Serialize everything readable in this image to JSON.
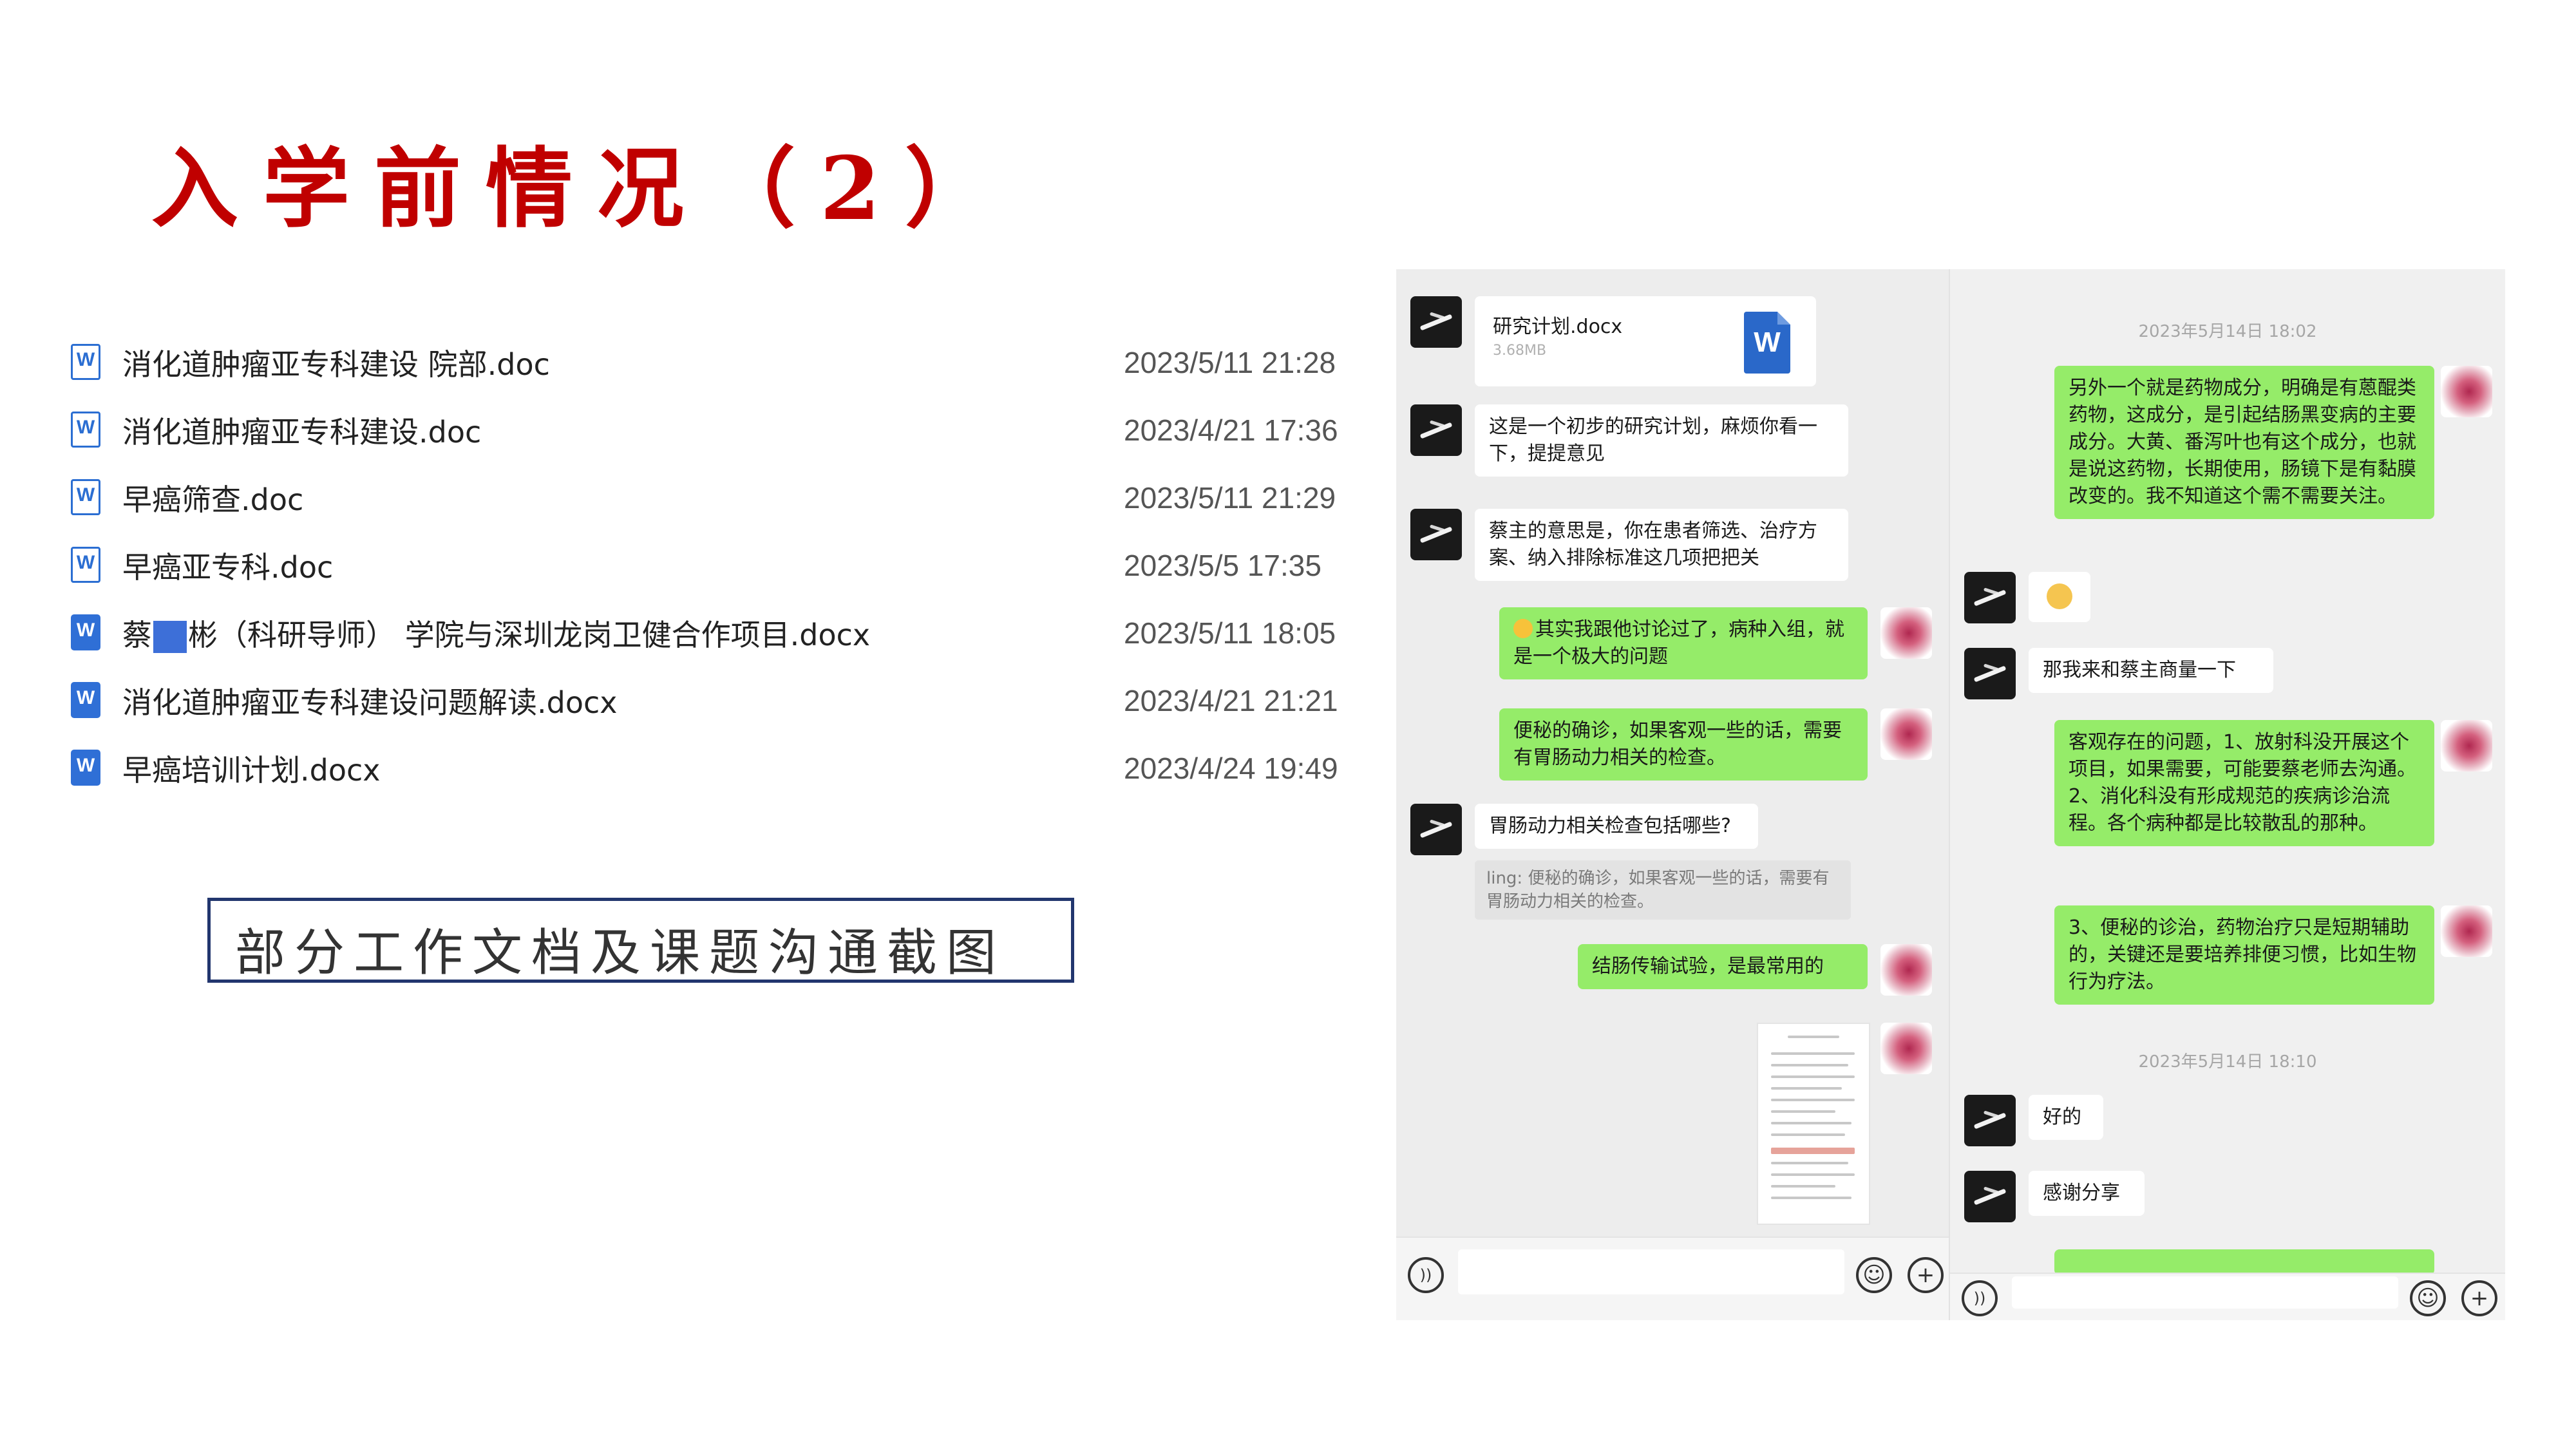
{
  "slide": {
    "title": "入学前情况（2）",
    "caption": "部分工作文档及课题沟通截图"
  },
  "files": [
    {
      "icon": "doc",
      "name": "消化道肿瘤亚专科建设 院部.doc",
      "date": "2023/5/11 21:28"
    },
    {
      "icon": "doc",
      "name": "消化道肿瘤亚专科建设.doc",
      "date": "2023/4/21 17:36"
    },
    {
      "icon": "doc",
      "name": "早癌筛查.doc",
      "date": "2023/5/11 21:29"
    },
    {
      "icon": "doc",
      "name": "早癌亚专科.doc",
      "date": "2023/5/5 17:35"
    },
    {
      "icon": "docx",
      "name_pre": "蔡",
      "name_post": "彬（科研导师） 学院与深圳龙岗卫健合作项目.docx",
      "date": "2023/5/11 18:05"
    },
    {
      "icon": "docx",
      "name": "消化道肿瘤亚专科建设问题解读.docx",
      "date": "2023/4/21 21:21"
    },
    {
      "icon": "docx",
      "name": "早癌培训计划.docx",
      "date": "2023/4/24 19:49"
    }
  ],
  "chat_left": {
    "file_card": {
      "name": "研究计划.docx",
      "size": "3.68MB",
      "icon_letter": "W"
    },
    "msg1": "这是一个初步的研究计划，麻烦你看一下，提提意见",
    "msg2": "蔡主的意思是，你在患者筛选、治疗方案、纳入排除标准这几项把把关",
    "msg3": "其实我跟他讨论过了，病种入组，就是一个极大的问题",
    "msg4": "便秘的确诊，如果客观一些的话，需要有胃肠动力相关的检查。",
    "msg5": "胃肠动力相关检查包括哪些?",
    "quote5": "ling: 便秘的确诊，如果客观一些的话，需要有胃肠动力相关的检查。",
    "msg6": "结肠传输试验，是最常用的"
  },
  "chat_right": {
    "time1": "2023年5月14日 18:02",
    "msg1": "另外一个就是药物成分，明确是有蒽醌类药物，这成分，是引起结肠黑变病的主要成分。大黄、番泻叶也有这个成分，也就是说这药物，长期使用，肠镜下是有黏膜改变的。我不知道这个需不需要关注。",
    "msg2": "那我来和蔡主商量一下",
    "msg3": "客观存在的问题，1、放射科没开展这个项目，如果需要，可能要蔡老师去沟通。2、消化科没有形成规范的疾病诊治流程。各个病种都是比较散乱的那种。",
    "msg4": "3、便秘的诊治，药物治疗只是短期辅助的，关键还是要培养排便习惯，比如生物行为疗法。",
    "time2": "2023年5月14日 18:10",
    "msg5": "好的",
    "msg6": "感谢分享"
  },
  "input_icons": {
    "voice": "voice-icon",
    "emoji": "emoji-icon",
    "plus": "plus-icon"
  },
  "colors": {
    "title": "#c00000",
    "green_bubble": "#95ec69",
    "caption_border": "#22366e",
    "docx_icon": "#2f6fd6"
  }
}
